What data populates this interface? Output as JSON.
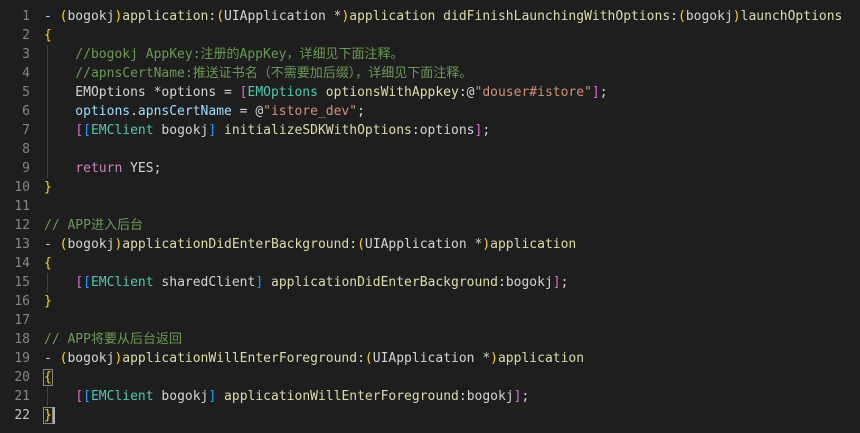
{
  "editor": {
    "language": "objective-c",
    "theme": "dark",
    "cursor_line": 22,
    "colors": {
      "background": "#1e1e1e",
      "line_number": "#858585",
      "line_number_active": "#c6c6c6",
      "plain": "#d4d4d4",
      "type": "#4ec9b0",
      "method": "#dcdcaa",
      "keyword": "#569cd6",
      "control": "#c586c0",
      "string": "#ce9178",
      "comment": "#6a9955",
      "variable": "#9cdcfe",
      "bracket_level_1": "#ffd700",
      "bracket_level_2": "#da70d6",
      "bracket_level_3": "#179fff"
    }
  },
  "lines": [
    {
      "number": "1",
      "tokens": [
        {
          "text": "- ",
          "kind": "plain"
        },
        {
          "text": "(",
          "kind": "b1"
        },
        {
          "text": "bogokj",
          "kind": "plain"
        },
        {
          "text": ")",
          "kind": "b1"
        },
        {
          "text": "application",
          "kind": "method"
        },
        {
          "text": ":",
          "kind": "plain"
        },
        {
          "text": "(",
          "kind": "b1"
        },
        {
          "text": "UIApplication *",
          "kind": "plain"
        },
        {
          "text": ")",
          "kind": "b1"
        },
        {
          "text": "application didFinishLaunchingWithOptions",
          "kind": "method"
        },
        {
          "text": ":",
          "kind": "plain"
        },
        {
          "text": "(",
          "kind": "b1"
        },
        {
          "text": "bogokj",
          "kind": "plain"
        },
        {
          "text": ")",
          "kind": "b1"
        },
        {
          "text": "launchOptions",
          "kind": "method"
        }
      ]
    },
    {
      "number": "2",
      "tokens": [
        {
          "text": "{",
          "kind": "b1"
        }
      ]
    },
    {
      "number": "3",
      "tokens": [
        {
          "text": "    //bogokj AppKey:注册的AppKey，详细见下面注释。",
          "kind": "comment"
        }
      ]
    },
    {
      "number": "4",
      "tokens": [
        {
          "text": "    //apnsCertName:推送证书名（不需要加后缀），详细见下面注释。",
          "kind": "comment"
        }
      ]
    },
    {
      "number": "5",
      "tokens": [
        {
          "text": "    EMOptions *options = ",
          "kind": "plain"
        },
        {
          "text": "[",
          "kind": "b2"
        },
        {
          "text": "EMOptions",
          "kind": "type"
        },
        {
          "text": " ",
          "kind": "plain"
        },
        {
          "text": "optionsWithAppkey",
          "kind": "method"
        },
        {
          "text": ":",
          "kind": "plain"
        },
        {
          "text": "@",
          "kind": "plain"
        },
        {
          "text": "\"douser#istore\"",
          "kind": "string"
        },
        {
          "text": "]",
          "kind": "b2"
        },
        {
          "text": ";",
          "kind": "plain"
        }
      ]
    },
    {
      "number": "6",
      "tokens": [
        {
          "text": "    options",
          "kind": "variable"
        },
        {
          "text": ".",
          "kind": "plain"
        },
        {
          "text": "apnsCertName",
          "kind": "variable"
        },
        {
          "text": " = @",
          "kind": "plain"
        },
        {
          "text": "\"istore_dev\"",
          "kind": "string"
        },
        {
          "text": ";",
          "kind": "plain"
        }
      ]
    },
    {
      "number": "7",
      "tokens": [
        {
          "text": "    ",
          "kind": "plain"
        },
        {
          "text": "[",
          "kind": "b2"
        },
        {
          "text": "[",
          "kind": "b3"
        },
        {
          "text": "EMClient",
          "kind": "type"
        },
        {
          "text": " bogokj",
          "kind": "plain"
        },
        {
          "text": "]",
          "kind": "b3"
        },
        {
          "text": " ",
          "kind": "plain"
        },
        {
          "text": "initializeSDKWithOptions",
          "kind": "method"
        },
        {
          "text": ":",
          "kind": "plain"
        },
        {
          "text": "options",
          "kind": "plain"
        },
        {
          "text": "]",
          "kind": "b2"
        },
        {
          "text": ";",
          "kind": "plain"
        }
      ]
    },
    {
      "number": "8",
      "tokens": []
    },
    {
      "number": "9",
      "tokens": [
        {
          "text": "    ",
          "kind": "plain"
        },
        {
          "text": "return",
          "kind": "control"
        },
        {
          "text": " YES;",
          "kind": "plain"
        }
      ]
    },
    {
      "number": "10",
      "tokens": [
        {
          "text": "}",
          "kind": "b1"
        }
      ]
    },
    {
      "number": "11",
      "tokens": []
    },
    {
      "number": "12",
      "tokens": [
        {
          "text": "// APP进入后台",
          "kind": "comment"
        }
      ]
    },
    {
      "number": "13",
      "tokens": [
        {
          "text": "- ",
          "kind": "plain"
        },
        {
          "text": "(",
          "kind": "b1"
        },
        {
          "text": "bogokj",
          "kind": "plain"
        },
        {
          "text": ")",
          "kind": "b1"
        },
        {
          "text": "applicationDidEnterBackground",
          "kind": "method"
        },
        {
          "text": ":",
          "kind": "plain"
        },
        {
          "text": "(",
          "kind": "b1"
        },
        {
          "text": "UIApplication *",
          "kind": "plain"
        },
        {
          "text": ")",
          "kind": "b1"
        },
        {
          "text": "application",
          "kind": "method"
        }
      ]
    },
    {
      "number": "14",
      "tokens": [
        {
          "text": "{",
          "kind": "b1"
        }
      ]
    },
    {
      "number": "15",
      "tokens": [
        {
          "text": "    ",
          "kind": "plain"
        },
        {
          "text": "[",
          "kind": "b2"
        },
        {
          "text": "[",
          "kind": "b3"
        },
        {
          "text": "EMClient",
          "kind": "type"
        },
        {
          "text": " sharedClient",
          "kind": "plain"
        },
        {
          "text": "]",
          "kind": "b3"
        },
        {
          "text": " ",
          "kind": "plain"
        },
        {
          "text": "applicationDidEnterBackground",
          "kind": "method"
        },
        {
          "text": ":",
          "kind": "plain"
        },
        {
          "text": "bogokj",
          "kind": "plain"
        },
        {
          "text": "]",
          "kind": "b2"
        },
        {
          "text": ";",
          "kind": "plain"
        }
      ]
    },
    {
      "number": "16",
      "tokens": [
        {
          "text": "}",
          "kind": "b1"
        }
      ]
    },
    {
      "number": "17",
      "tokens": []
    },
    {
      "number": "18",
      "tokens": [
        {
          "text": "// APP将要从后台返回",
          "kind": "comment"
        }
      ]
    },
    {
      "number": "19",
      "tokens": [
        {
          "text": "- ",
          "kind": "plain"
        },
        {
          "text": "(",
          "kind": "b1"
        },
        {
          "text": "bogokj",
          "kind": "plain"
        },
        {
          "text": ")",
          "kind": "b1"
        },
        {
          "text": "applicationWillEnterForeground",
          "kind": "method"
        },
        {
          "text": ":",
          "kind": "plain"
        },
        {
          "text": "(",
          "kind": "b1"
        },
        {
          "text": "UIApplication *",
          "kind": "plain"
        },
        {
          "text": ")",
          "kind": "b1"
        },
        {
          "text": "application",
          "kind": "method"
        }
      ]
    },
    {
      "number": "20",
      "tokens": [
        {
          "text": "{",
          "kind": "b1"
        }
      ]
    },
    {
      "number": "21",
      "tokens": [
        {
          "text": "    ",
          "kind": "plain"
        },
        {
          "text": "[",
          "kind": "b2"
        },
        {
          "text": "[",
          "kind": "b3"
        },
        {
          "text": "EMClient",
          "kind": "type"
        },
        {
          "text": " bogokj",
          "kind": "plain"
        },
        {
          "text": "]",
          "kind": "b3"
        },
        {
          "text": " ",
          "kind": "plain"
        },
        {
          "text": "applicationWillEnterForeground",
          "kind": "method"
        },
        {
          "text": ":",
          "kind": "plain"
        },
        {
          "text": "bogokj",
          "kind": "plain"
        },
        {
          "text": "]",
          "kind": "b2"
        },
        {
          "text": ";",
          "kind": "plain"
        }
      ]
    },
    {
      "number": "22",
      "tokens": [
        {
          "text": "}",
          "kind": "b1"
        }
      ]
    }
  ]
}
